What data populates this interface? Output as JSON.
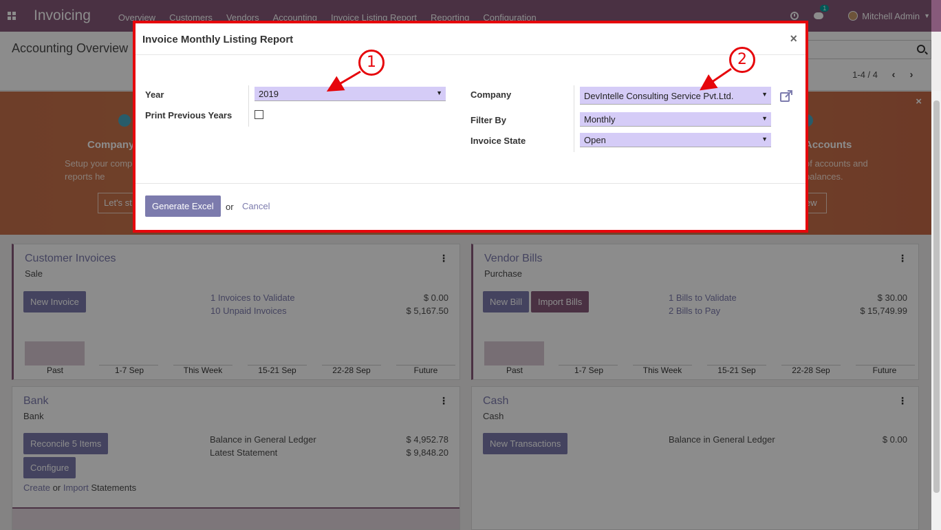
{
  "navbar": {
    "brand": "Invoicing",
    "menu": [
      "Overview",
      "Customers",
      "Vendors",
      "Accounting",
      "Invoice Listing Report",
      "Reporting",
      "Configuration"
    ],
    "chat_count": "1",
    "user": "Mitchell Admin"
  },
  "control_panel": {
    "breadcrumb": "Accounting Overview",
    "pager": "1-4 / 4"
  },
  "banner": {
    "left_title": "Company",
    "left_text": "Setup your comp reports he",
    "left_button": "Let's st",
    "right_title": "Accounts",
    "right_text": "of accounts and balances.",
    "right_button": "ew"
  },
  "cards": {
    "customer": {
      "title": "Customer Invoices",
      "subtitle": "Sale",
      "button": "New Invoice",
      "lines": [
        {
          "label": "1 Invoices to Validate",
          "amount": "$ 0.00"
        },
        {
          "label": "10 Unpaid Invoices",
          "amount": "$ 5,167.50"
        }
      ],
      "graph_labels": [
        "Past",
        "1-7 Sep",
        "This Week",
        "15-21 Sep",
        "22-28 Sep",
        "Future"
      ]
    },
    "vendor": {
      "title": "Vendor Bills",
      "subtitle": "Purchase",
      "button1": "New Bill",
      "button2": "Import Bills",
      "lines": [
        {
          "label": "1 Bills to Validate",
          "amount": "$ 30.00"
        },
        {
          "label": "2 Bills to Pay",
          "amount": "$ 15,749.99"
        }
      ],
      "graph_labels": [
        "Past",
        "1-7 Sep",
        "This Week",
        "15-21 Sep",
        "22-28 Sep",
        "Future"
      ]
    },
    "bank": {
      "title": "Bank",
      "subtitle": "Bank",
      "button1": "Reconcile 5 Items",
      "button2": "Configure",
      "create": "Create",
      "or": "or",
      "import": "Import",
      "statements": "Statements",
      "lines": [
        {
          "label": "Balance in General Ledger",
          "amount": "$ 4,952.78"
        },
        {
          "label": "Latest Statement",
          "amount": "$ 9,848.20"
        }
      ]
    },
    "cash": {
      "title": "Cash",
      "subtitle": "Cash",
      "button": "New Transactions",
      "lines": [
        {
          "label": "Balance in General Ledger",
          "amount": "$ 0.00"
        }
      ]
    }
  },
  "modal": {
    "title": "Invoice Monthly Listing Report",
    "close": "×",
    "year_label": "Year",
    "year_value": "2019",
    "print_prev_label": "Print Previous Years",
    "company_label": "Company",
    "company_value": "DevIntelle Consulting Service Pvt.Ltd.",
    "filter_label": "Filter By",
    "filter_value": "Monthly",
    "state_label": "Invoice State",
    "state_value": "Open",
    "generate_button": "Generate Excel",
    "or": "or",
    "cancel": "Cancel"
  },
  "annotations": [
    "1",
    "2"
  ],
  "colors": {
    "primary": "#875a7b",
    "link": "#7c7bad",
    "highlight": "#e6060b",
    "select_bg": "#d5ccf7"
  }
}
